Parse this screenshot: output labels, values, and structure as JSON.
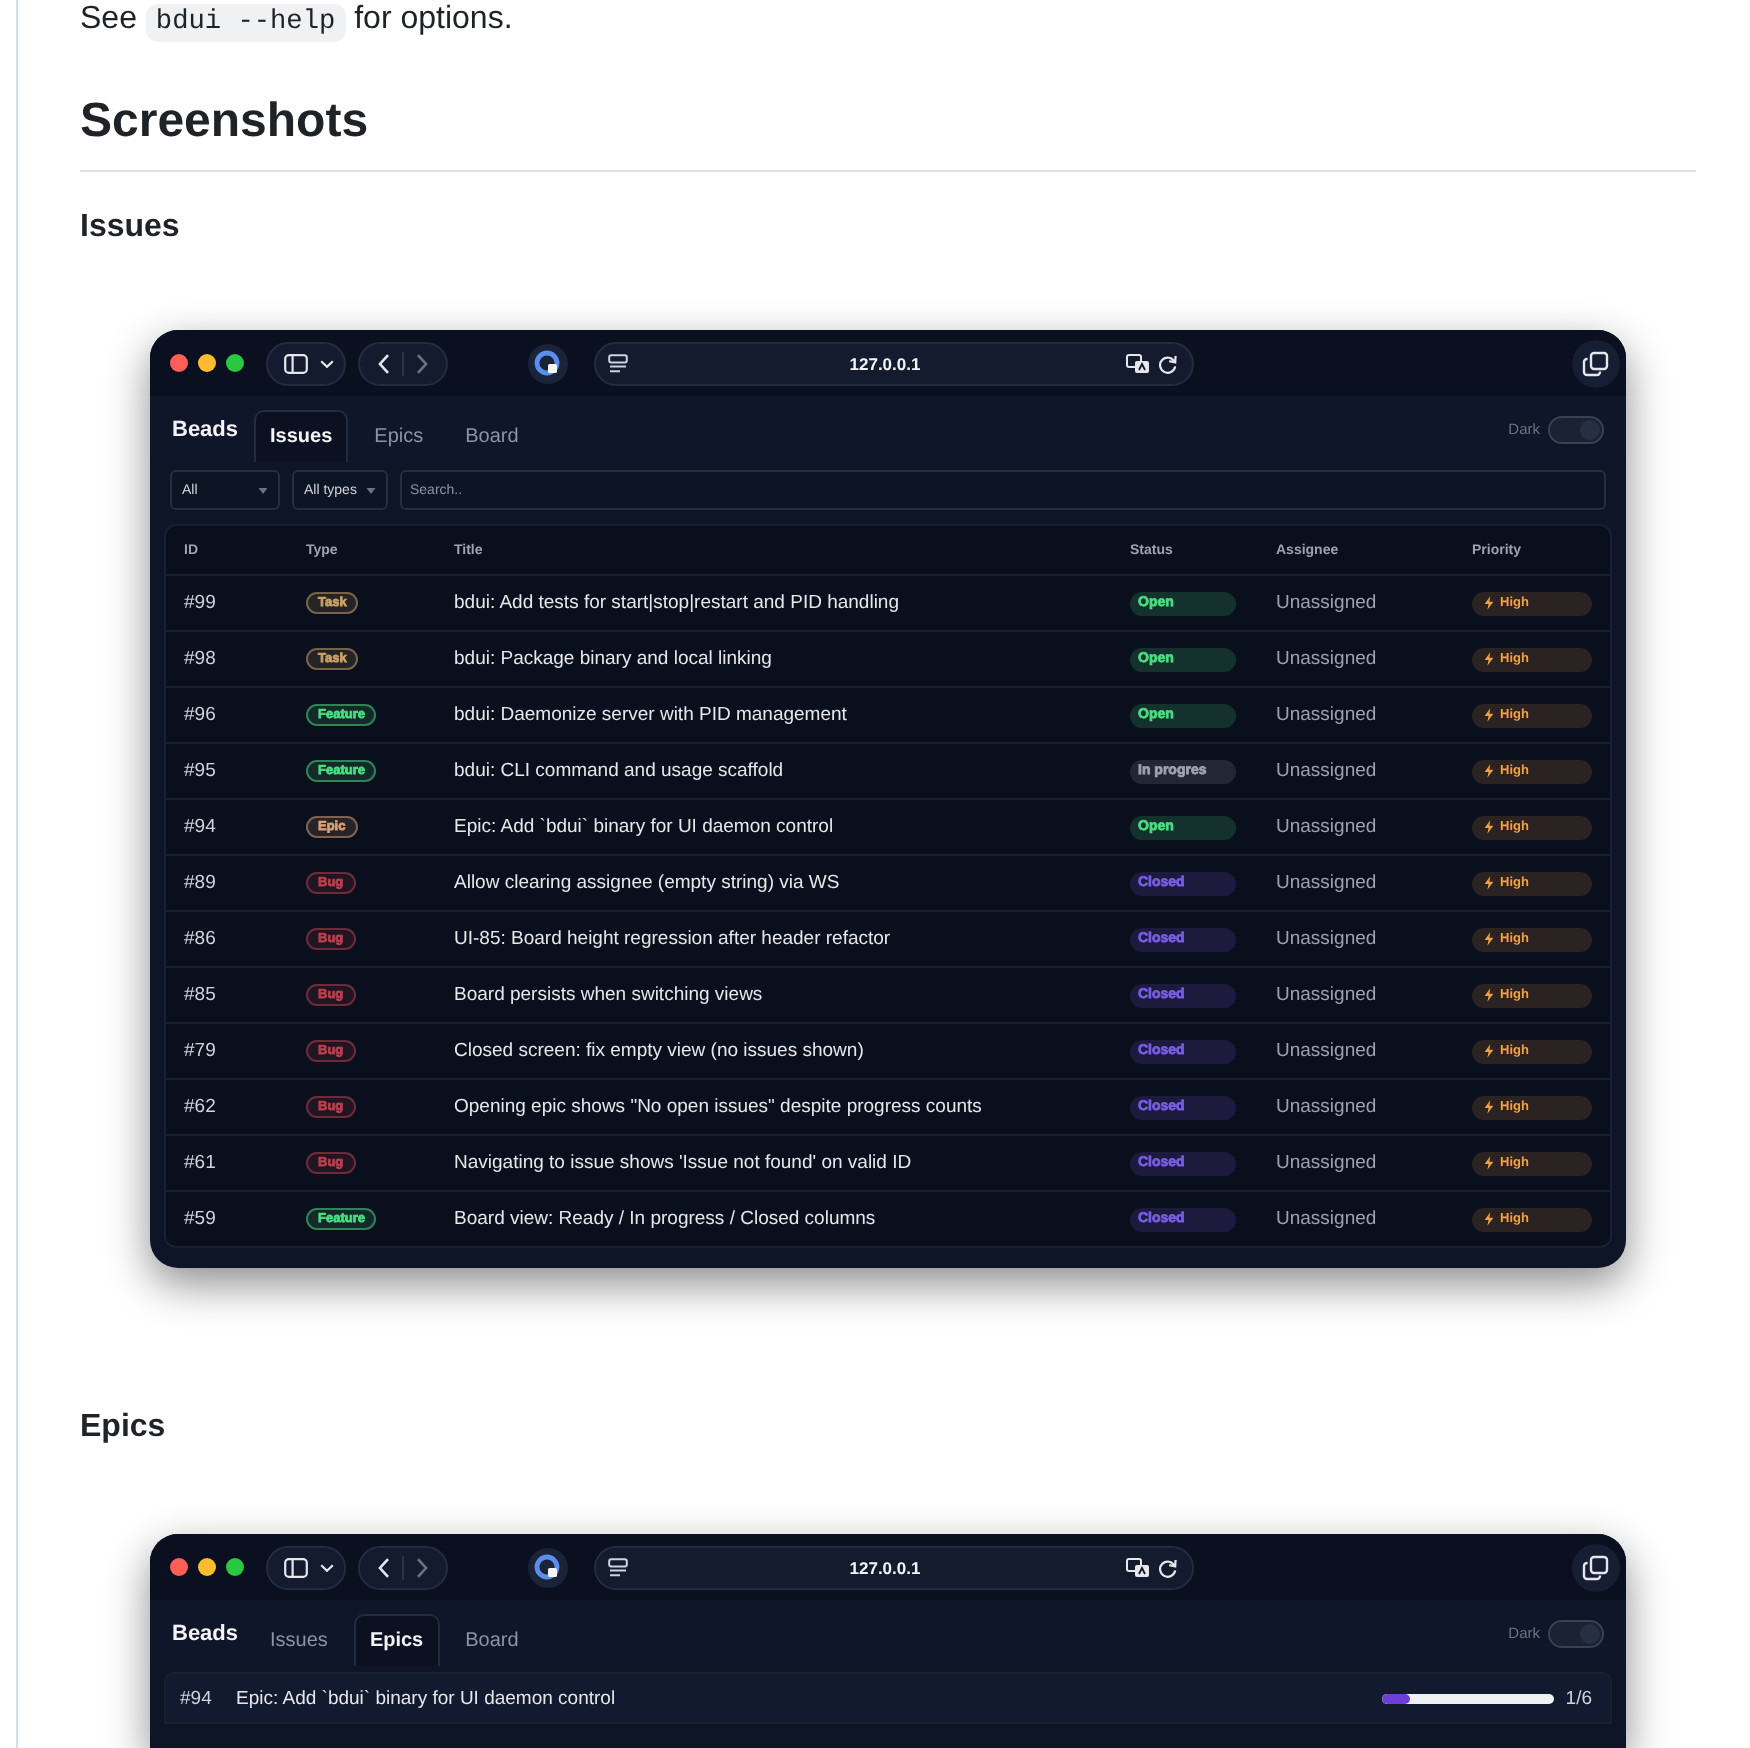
{
  "intro": {
    "before": "See",
    "code": "bdui --help",
    "after": "for options."
  },
  "heading": "Screenshots",
  "sections": [
    {
      "title": "Issues",
      "window": {
        "url": "127.0.0.1",
        "brand": "Beads",
        "tabs": [
          {
            "label": "Issues",
            "selected": true
          },
          {
            "label": "Epics",
            "selected": false
          },
          {
            "label": "Board",
            "selected": false
          }
        ],
        "theme_toggle": {
          "label": "Dark",
          "on": true
        },
        "view": {
          "kind": "issues",
          "filters": [
            {
              "kind": "select",
              "value": "All"
            },
            {
              "kind": "select",
              "value": "All types"
            },
            {
              "kind": "search",
              "placeholder": "Search.."
            }
          ],
          "table": {
            "columns": [
              "ID",
              "Type",
              "Title",
              "Status",
              "Assignee",
              "Priority"
            ],
            "rows": [
              {
                "id": "#99",
                "type": {
                  "label": "Task",
                  "color": "#c9a265"
                },
                "title": "bdui: Add tests for start|stop|restart and PID handling",
                "status": {
                  "label": "Open",
                  "color": "#4ade80"
                },
                "assignee": "Unassigned",
                "priority": {
                  "label": "High",
                  "color": "#f5a142"
                }
              },
              {
                "id": "#98",
                "type": {
                  "label": "Task",
                  "color": "#c9a265"
                },
                "title": "bdui: Package binary and local linking",
                "status": {
                  "label": "Open",
                  "color": "#4ade80"
                },
                "assignee": "Unassigned",
                "priority": {
                  "label": "High",
                  "color": "#f5a142"
                }
              },
              {
                "id": "#96",
                "type": {
                  "label": "Feature",
                  "color": "#4ade80"
                },
                "title": "bdui: Daemonize server with PID management",
                "status": {
                  "label": "Open",
                  "color": "#4ade80"
                },
                "assignee": "Unassigned",
                "priority": {
                  "label": "High",
                  "color": "#f5a142"
                }
              },
              {
                "id": "#95",
                "type": {
                  "label": "Feature",
                  "color": "#4ade80"
                },
                "title": "bdui: CLI command and usage scaffold",
                "status": {
                  "label": "In progres",
                  "color": "#9ca3af"
                },
                "assignee": "Unassigned",
                "priority": {
                  "label": "High",
                  "color": "#f5a142"
                }
              },
              {
                "id": "#94",
                "type": {
                  "label": "Epic",
                  "color": "#d9a074"
                },
                "title": "Epic: Add `bdui` binary for UI daemon control",
                "status": {
                  "label": "Open",
                  "color": "#4ade80"
                },
                "assignee": "Unassigned",
                "priority": {
                  "label": "High",
                  "color": "#f5a142"
                }
              },
              {
                "id": "#89",
                "type": {
                  "label": "Bug",
                  "color": "#b8414e"
                },
                "title": "Allow clearing assignee (empty string) via WS",
                "status": {
                  "label": "Closed",
                  "color": "#7c5ce6"
                },
                "assignee": "Unassigned",
                "priority": {
                  "label": "High",
                  "color": "#f5a142"
                }
              },
              {
                "id": "#86",
                "type": {
                  "label": "Bug",
                  "color": "#b8414e"
                },
                "title": "UI-85: Board height regression after header refactor",
                "status": {
                  "label": "Closed",
                  "color": "#7c5ce6"
                },
                "assignee": "Unassigned",
                "priority": {
                  "label": "High",
                  "color": "#f5a142"
                }
              },
              {
                "id": "#85",
                "type": {
                  "label": "Bug",
                  "color": "#b8414e"
                },
                "title": "Board persists when switching views",
                "status": {
                  "label": "Closed",
                  "color": "#7c5ce6"
                },
                "assignee": "Unassigned",
                "priority": {
                  "label": "High",
                  "color": "#f5a142"
                }
              },
              {
                "id": "#79",
                "type": {
                  "label": "Bug",
                  "color": "#b8414e"
                },
                "title": "Closed screen: fix empty view (no issues shown)",
                "status": {
                  "label": "Closed",
                  "color": "#7c5ce6"
                },
                "assignee": "Unassigned",
                "priority": {
                  "label": "High",
                  "color": "#f5a142"
                }
              },
              {
                "id": "#62",
                "type": {
                  "label": "Bug",
                  "color": "#b8414e"
                },
                "title": "Opening epic shows \"No open issues\" despite progress counts",
                "status": {
                  "label": "Closed",
                  "color": "#7c5ce6"
                },
                "assignee": "Unassigned",
                "priority": {
                  "label": "High",
                  "color": "#f5a142"
                }
              },
              {
                "id": "#61",
                "type": {
                  "label": "Bug",
                  "color": "#b8414e"
                },
                "title": "Navigating to issue shows 'Issue not found' on valid ID",
                "status": {
                  "label": "Closed",
                  "color": "#7c5ce6"
                },
                "assignee": "Unassigned",
                "priority": {
                  "label": "High",
                  "color": "#f5a142"
                }
              },
              {
                "id": "#59",
                "type": {
                  "label": "Feature",
                  "color": "#4ade80"
                },
                "title": "Board view: Ready / In progress / Closed columns",
                "status": {
                  "label": "Closed",
                  "color": "#7c5ce6"
                },
                "assignee": "Unassigned",
                "priority": {
                  "label": "High",
                  "color": "#f5a142"
                }
              }
            ]
          }
        }
      }
    },
    {
      "title": "Epics",
      "window": {
        "url": "127.0.0.1",
        "brand": "Beads",
        "tabs": [
          {
            "label": "Issues",
            "selected": false
          },
          {
            "label": "Epics",
            "selected": true
          },
          {
            "label": "Board",
            "selected": false
          }
        ],
        "theme_toggle": {
          "label": "Dark",
          "on": true
        },
        "view": {
          "kind": "epics",
          "epic": {
            "id": "#94",
            "title": "Epic: Add `bdui` binary for UI daemon control",
            "level": 0.17,
            "count": "1/6"
          }
        }
      }
    }
  ]
}
